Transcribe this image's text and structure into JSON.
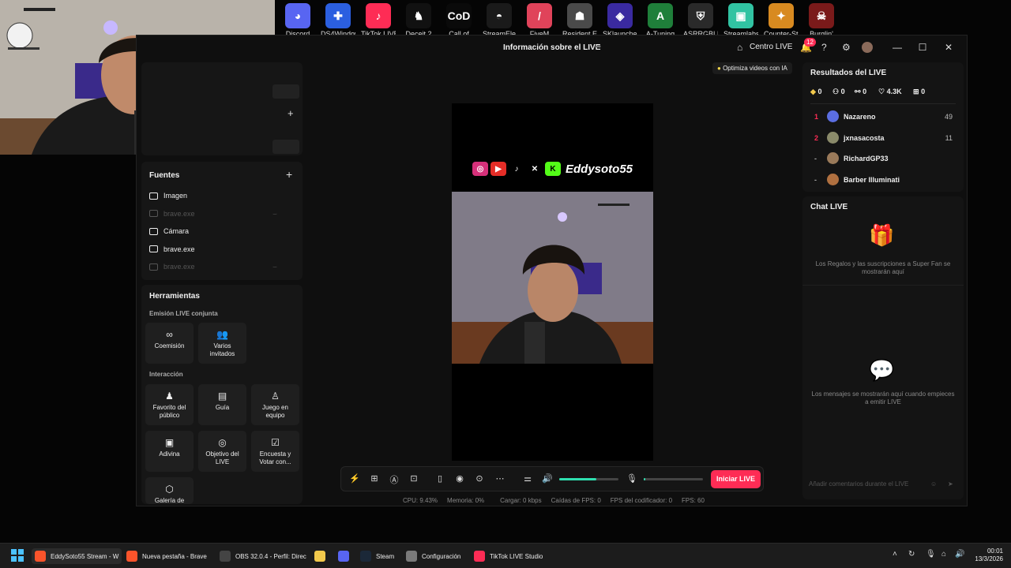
{
  "desktop": {
    "icons": [
      {
        "label": "Discord",
        "icon": "discord-icon",
        "color": "#5865f2",
        "glyph": "◕"
      },
      {
        "label": "DS4Windows",
        "icon": "gamepad-icon",
        "color": "#2b5fe0",
        "glyph": "✚"
      },
      {
        "label": "TikTok LIVE",
        "icon": "tiktok-icon",
        "color": "#fe2c55",
        "glyph": "♪"
      },
      {
        "label": "Deceit 2",
        "icon": "rabbit-icon",
        "color": "#111111",
        "glyph": "♞"
      },
      {
        "label": "Call of",
        "icon": "cod-icon",
        "color": "#0a0a0a",
        "glyph": "CoD"
      },
      {
        "label": "StreamEle",
        "icon": "streamelements-icon",
        "color": "#1a1a1a",
        "glyph": "◓"
      },
      {
        "label": "FiveM",
        "icon": "fivem-icon",
        "color": "#e0435a",
        "glyph": "/"
      },
      {
        "label": "Resident Evil",
        "icon": "re-icon",
        "color": "#4a4a4a",
        "glyph": "☗"
      },
      {
        "label": "SKlauncher",
        "icon": "sklauncher-icon",
        "color": "#3a2aa0",
        "glyph": "◈"
      },
      {
        "label": "A-Tuning",
        "icon": "atuning-icon",
        "color": "#1f7f3a",
        "glyph": "A"
      },
      {
        "label": "ASRRGBLED",
        "icon": "asrock-icon",
        "color": "#2a2a2a",
        "glyph": "⛨"
      },
      {
        "label": "Streamlabs",
        "icon": "streamlabs-icon",
        "color": "#31c3a2",
        "glyph": "▣"
      },
      {
        "label": "Counter-Str",
        "icon": "cs-icon",
        "color": "#d88a20",
        "glyph": "✦"
      },
      {
        "label": "Burglin'",
        "icon": "burglin-icon",
        "color": "#7a1a1a",
        "glyph": "☠"
      }
    ]
  },
  "window": {
    "title": "Información sobre el LIVE",
    "centro_live": "Centro LIVE",
    "notifications": "12",
    "optimiza": "Optimiza videos con IA"
  },
  "sources": {
    "title": "Fuentes",
    "items": [
      {
        "label": "Imagen",
        "dim": false
      },
      {
        "label": "brave.exe",
        "dim": true
      },
      {
        "label": "Cámara",
        "dim": false
      },
      {
        "label": "brave.exe",
        "dim": false
      },
      {
        "label": "brave.exe",
        "dim": true
      }
    ]
  },
  "tools": {
    "title": "Herramientas",
    "co_stream_label": "Emisión LIVE conjunta",
    "interaction_label": "Interacción",
    "coemision": "Coemisión",
    "varios": "Varios invitados",
    "favorito": "Favorito del público",
    "guia": "Guía",
    "juego": "Juego en equipo",
    "adivina": "Adivina",
    "objetivo": "Objetivo del LIVE",
    "encuesta": "Encuesta y Votar con...",
    "galeria": "Galería de"
  },
  "preview": {
    "banner_name": "Eddysoto55"
  },
  "controls": {
    "go_live": "Iniciar LIVE",
    "volume_level": 0.62,
    "mic_level": 0.03
  },
  "stats": {
    "cpu": "CPU:  9.43%",
    "mem": "Memoria:  0%",
    "load": "Cargar:  0 kbps",
    "fps_drops": "Caídas de FPS:  0",
    "encoder": "FPS del codificador:  0",
    "fps": "FPS:  60"
  },
  "results": {
    "title": "Resultados del LIVE",
    "diamonds": "0",
    "viewers": "0",
    "shares": "0",
    "likes": "4.3K",
    "gifts": "0",
    "ranking": [
      {
        "rank": "1",
        "name": "Nazareno",
        "value": "49",
        "avatar_color": "#5b6ee1"
      },
      {
        "rank": "2",
        "name": "jxnasacosta",
        "value": "11",
        "avatar_color": "#8a8a6a"
      },
      {
        "rank": "-",
        "name": "RichardGP33",
        "value": "",
        "avatar_color": "#9a7a5a"
      },
      {
        "rank": "-",
        "name": "Barber Illuminati",
        "value": "",
        "avatar_color": "#b07040"
      }
    ]
  },
  "chat": {
    "title": "Chat LIVE",
    "gifts_msg": "Los Regalos y las suscripciones a Super Fan se mostrarán aquí",
    "messages_msg": "Los mensajes se mostrarán aquí cuando empieces a emitir LIVE",
    "input_placeholder": "Añadir comentarios durante el LIVE"
  },
  "taskbar": {
    "apps": [
      {
        "label": "EddySoto55 Stream - W",
        "color": "#fb542b",
        "active": true
      },
      {
        "label": "Nueva pestaña - Brave",
        "color": "#fb542b",
        "active": false
      },
      {
        "label": "OBS 32.0.4 - Perfil: Direc",
        "color": "#444444",
        "active": false
      },
      {
        "label": "",
        "color": "#f2c94c",
        "active": false
      },
      {
        "label": "",
        "color": "#5865f2",
        "active": false
      },
      {
        "label": "Steam",
        "color": "#1b2838",
        "active": false
      },
      {
        "label": "Configuración",
        "color": "#7a7a7a",
        "active": false
      },
      {
        "label": "TikTok LIVE Studio",
        "color": "#fe2c55",
        "active": false
      }
    ],
    "time": "00:01",
    "date": "13/3/2026"
  }
}
